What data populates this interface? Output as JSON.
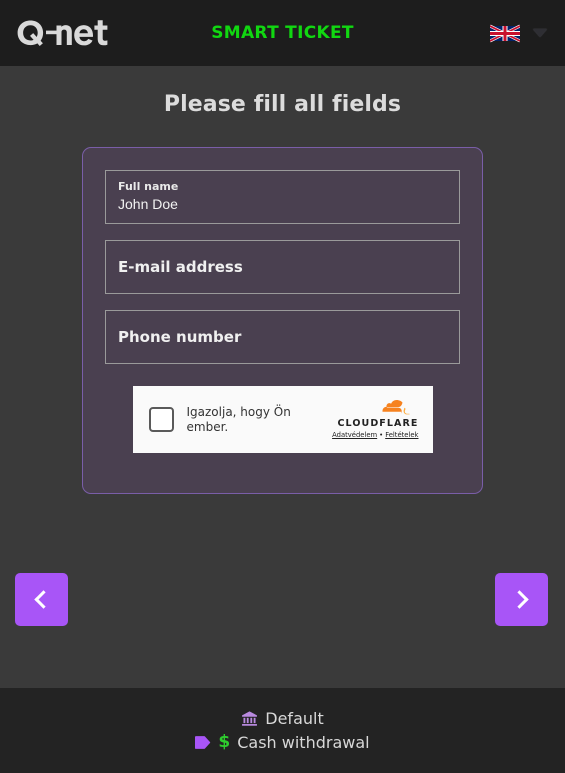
{
  "header": {
    "logo_text": "Qnet",
    "logo_icon": "qnet-logo",
    "brand_title": "SMART TICKET",
    "flag_icon": "uk-flag-icon",
    "flag_label": "English",
    "chevron_icon": "chevron-down-icon"
  },
  "main": {
    "page_title": "Please fill all fields",
    "fields": [
      {
        "label": "Full name",
        "value": "John Doe",
        "filled": true
      },
      {
        "label": "E-mail address",
        "value": "",
        "filled": false
      },
      {
        "label": "Phone number",
        "value": "",
        "filled": false
      }
    ]
  },
  "turnstile": {
    "checkbox_icon": "checkbox-unchecked-icon",
    "checked": false,
    "prompt": "Igazolja, hogy Ön ember.",
    "logo_icon": "cloudflare-cloud-icon",
    "brand": "CLOUDFLARE",
    "privacy_link": "Adatvédelem",
    "separator": "•",
    "terms_link": "Feltételek"
  },
  "nav": {
    "prev_icon": "chevron-left-icon",
    "prev_label": "Previous",
    "next_icon": "chevron-right-icon",
    "next_label": "Next"
  },
  "footer": {
    "rows": [
      {
        "icon": "bank-icon",
        "label": "Default"
      },
      {
        "icon": "tag-icon",
        "secondary_icon": "dollar-icon",
        "dollar": "$",
        "label": "Cash withdrawal"
      }
    ]
  },
  "colors": {
    "header_bg": "#1d1d1d",
    "body_bg": "#3a3a3a",
    "footer_bg": "#232323",
    "panel_bg": "#4a4050",
    "panel_border": "#7a5ea8",
    "accent_purple": "#a855f7",
    "brand_green": "#11d711",
    "cloudflare_orange": "#f48120",
    "dollar_green": "#2ecc2e"
  }
}
